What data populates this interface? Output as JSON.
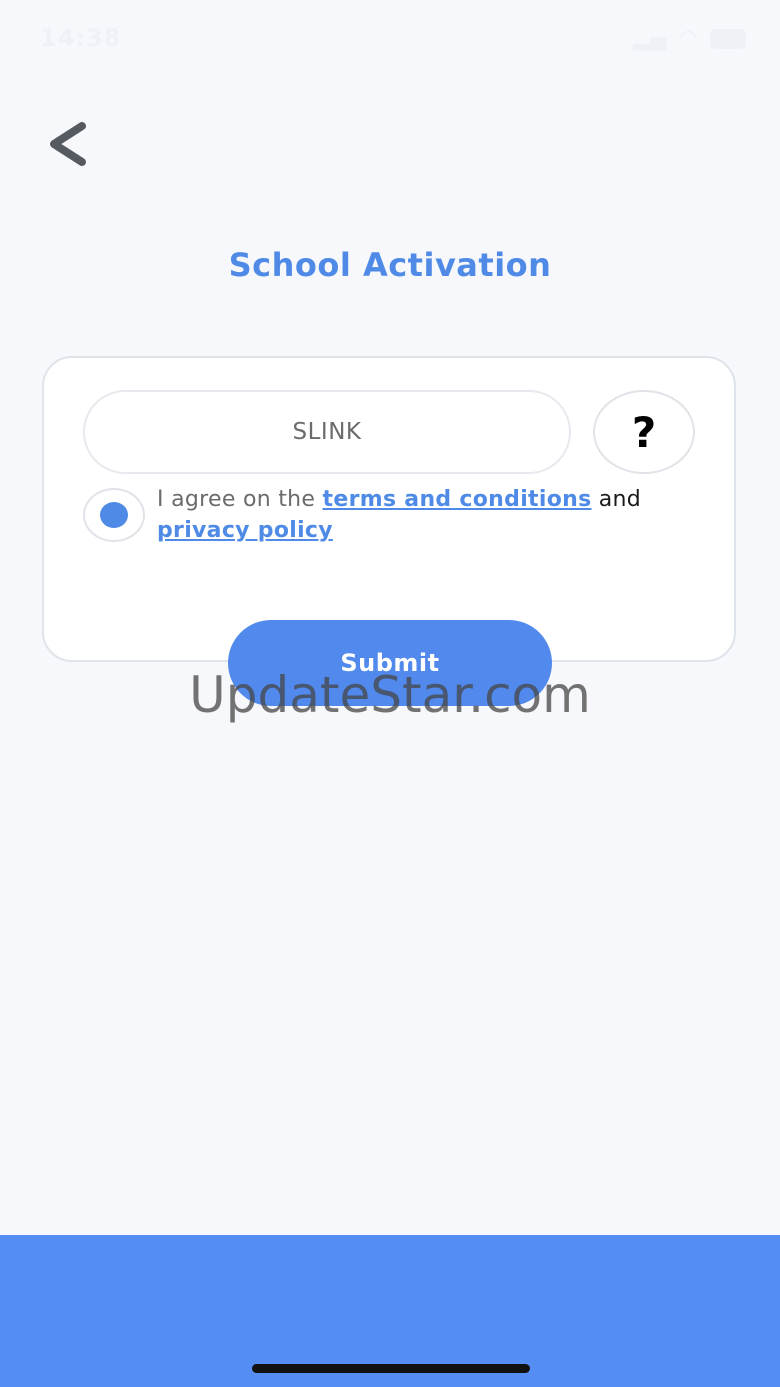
{
  "status_bar": {
    "time": "14:38"
  },
  "header": {
    "title": "School Activation"
  },
  "form": {
    "code_placeholder": "SLINK",
    "help_label": "?",
    "agree_prefix": "I agree on the ",
    "terms_link": "terms and conditions",
    "conjunction": " and ",
    "privacy_link": "privacy policy",
    "agreed": true,
    "submit_label": "Submit"
  },
  "watermark": "UpdateStar.com",
  "colors": {
    "accent": "#4f8be6",
    "bottom_bar": "#558ef2",
    "background": "#f6f8fc"
  }
}
